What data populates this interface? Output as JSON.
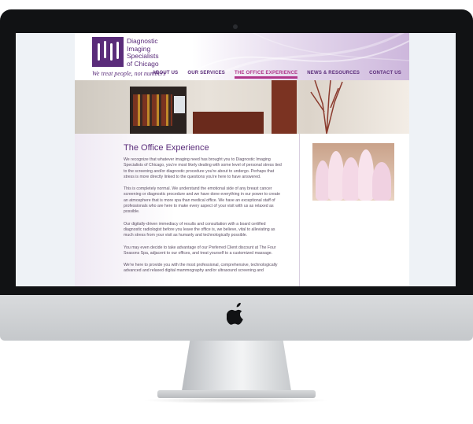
{
  "site": {
    "logo_text": [
      "Diagnostic",
      "Imaging",
      "Specialists",
      "of Chicago"
    ],
    "tagline": "We treat people, not numbers",
    "nav": [
      {
        "label": "ABOUT US",
        "active": false
      },
      {
        "label": "OUR SERVICES",
        "active": false
      },
      {
        "label": "THE OFFICE EXPERIENCE",
        "active": true
      },
      {
        "label": "NEWS & RESOURCES",
        "active": false
      },
      {
        "label": "CONTACT US",
        "active": false
      }
    ],
    "page_title": "The Office Experience",
    "paragraphs": [
      "We recognize that whatever imaging need has brought you to Diagnostic Imaging Specialists of Chicago, you're most likely dealing with some level of personal stress tied to the screening and/or diagnostic procedure you're about to undergo. Perhaps that stress is more directly linked to the questions you're here to have answered.",
      "This is completely normal. We understand the emotional side of any breast cancer screening or diagnostic procedure and we have done everything in our power to create an atmosphere that is more spa than medical office. We have an exceptional staff of professionals who are here to make every aspect of your visit with us as relaxed as possible.",
      "Our digitally-driven immediacy of results and consultation with a board certified diagnostic radiologist before you leave the office is, we believe, vital to alleviating as much stress from your visit as humanly and technologically possible.",
      "You may even decide to take advantage of our Preferred Client discount at The Four Seasons Spa, adjacent to our offices, and treat yourself to a customized massage.",
      "We're here to provide you with the most professional, comprehensive, technologically advanced and relaxed digital mammography and/or ultrasound screening and"
    ]
  },
  "colors": {
    "brand_purple": "#5a2c7a",
    "active_pink": "#b0368a",
    "bezel": "#111214"
  },
  "icons": {
    "apple": "apple-logo-icon"
  }
}
